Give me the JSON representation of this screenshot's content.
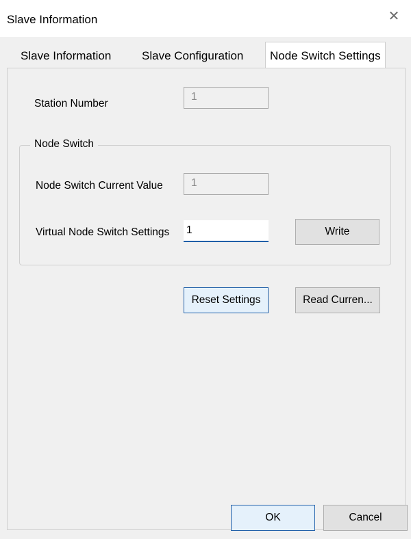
{
  "window": {
    "title": "Slave Information",
    "close_glyph": "✕"
  },
  "tabs": [
    {
      "label": "Slave Information",
      "active": false
    },
    {
      "label": "Slave Configuration",
      "active": false
    },
    {
      "label": "Node Switch Settings",
      "active": true
    }
  ],
  "station": {
    "label": "Station Number",
    "value": "1"
  },
  "node_switch": {
    "group_title": "Node Switch",
    "current_label": "Node Switch Current Value",
    "current_value": "1",
    "virtual_label": "Virtual Node Switch Settings",
    "virtual_value": "1",
    "write_label": "Write"
  },
  "actions": {
    "reset_label": "Reset Settings",
    "read_label": "Read Curren..."
  },
  "footer": {
    "ok_label": "OK",
    "cancel_label": "Cancel"
  },
  "colors": {
    "accent": "#1f5fa8",
    "background": "#f0f0f0",
    "button": "#e1e1e1"
  }
}
